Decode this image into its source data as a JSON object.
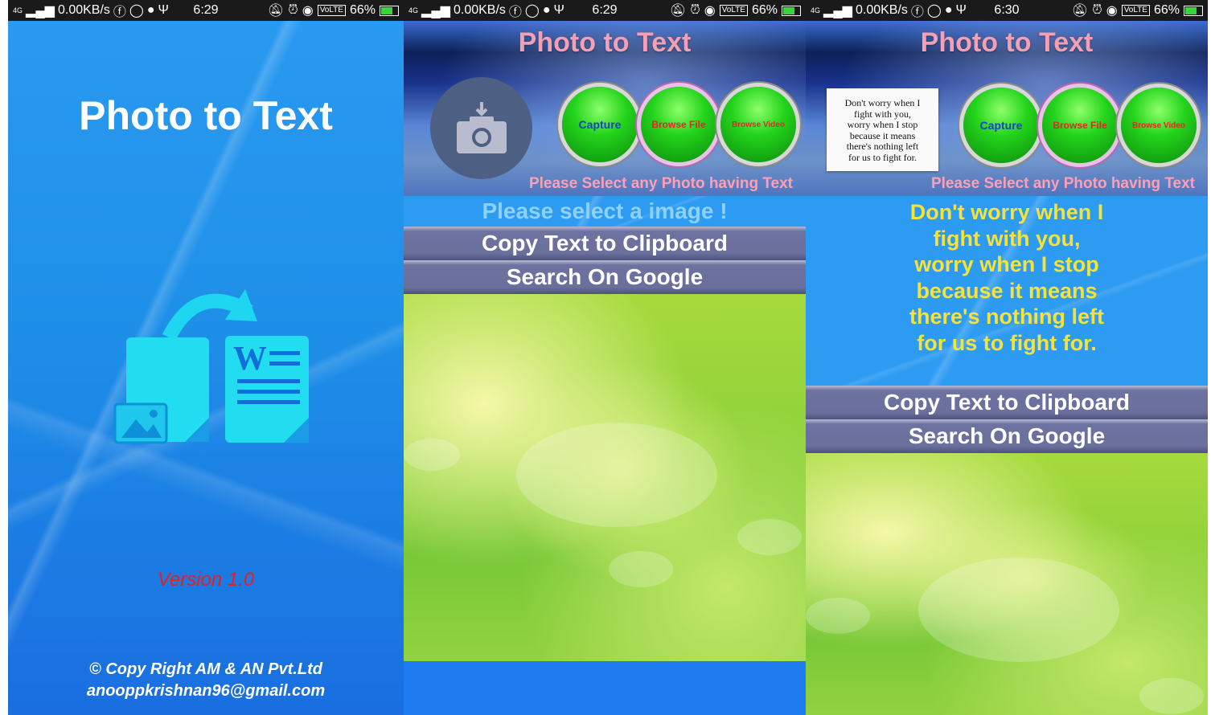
{
  "status_bar": {
    "network": "4G",
    "speed": "0.00KB/s",
    "volte": "VoLTE",
    "battery": "66%",
    "screen1_time": "6:29",
    "screen2_time": "6:29",
    "screen3_time": "6:30"
  },
  "splash": {
    "title": "Photo to Text",
    "version": "Version 1.0",
    "copyright": "© Copy Right AM & AN Pvt.Ltd",
    "email": "anooppkrishnan96@gmail.com"
  },
  "app": {
    "title": "Photo to Text",
    "capture_label": "Capture",
    "browse_file_label": "Browse File",
    "browse_video_label": "Browse Video",
    "prompt": "Please Select any Photo having Text",
    "empty_message": "Please select a image !",
    "copy_button": "Copy Text to Clipboard",
    "search_button": "Search On Google"
  },
  "screen3": {
    "preview_lines": [
      "Don't worry when I",
      "fight with you,",
      "worry when I stop",
      "because it means",
      "there's nothing left",
      "for us to fight for."
    ],
    "result_lines": [
      "Don't worry when I",
      "fight with you,",
      "worry when I stop",
      "because it means",
      "there's nothing left",
      "for us to fight for."
    ]
  },
  "colors": {
    "title_pink": "#f4a0b4",
    "result_yellow": "#f5e23a",
    "version_red": "#e32020",
    "splash_blue": "#2a9af0"
  }
}
